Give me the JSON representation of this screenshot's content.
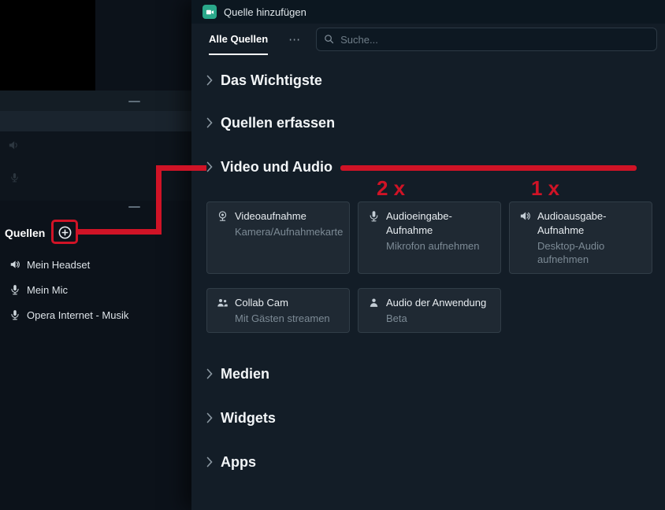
{
  "left": {
    "sources_title": "Quellen",
    "items": [
      {
        "label": "Mein Headset",
        "icon": "speaker"
      },
      {
        "label": "Mein Mic",
        "icon": "microphone"
      },
      {
        "label": "Opera Internet - Musik",
        "icon": "microphone"
      }
    ]
  },
  "dialog": {
    "title": "Quelle hinzufügen",
    "tab_all": "Alle Quellen",
    "more": "⋯",
    "search_placeholder": "Suche...",
    "sections": [
      {
        "label": "Das Wichtigste"
      },
      {
        "label": "Quellen erfassen"
      },
      {
        "label": "Video und Audio"
      },
      {
        "label": "Medien"
      },
      {
        "label": "Widgets"
      },
      {
        "label": "Apps"
      }
    ],
    "cards": [
      {
        "title": "Videoaufnahme",
        "subtitle": "Kamera/Aufnahmekarte",
        "icon": "webcam"
      },
      {
        "title": "Audioeingabe-Aufnahme",
        "subtitle": "Mikrofon aufnehmen",
        "icon": "microphone"
      },
      {
        "title": "Audioausgabe-Aufnahme",
        "subtitle": "Desktop-Audio aufnehmen",
        "icon": "speaker"
      },
      {
        "title": "Collab Cam",
        "subtitle": "Mit Gästen streamen",
        "icon": "users"
      },
      {
        "title": "Audio der Anwendung",
        "subtitle": "Beta",
        "icon": "user"
      }
    ]
  },
  "annotations": {
    "mic_count": "2 x",
    "speaker_count": "1 x"
  },
  "colors": {
    "annotation_red": "#d01326",
    "brand_green": "#2aa88a",
    "dialog_background": "#131d27",
    "card_background": "#1f2933"
  }
}
